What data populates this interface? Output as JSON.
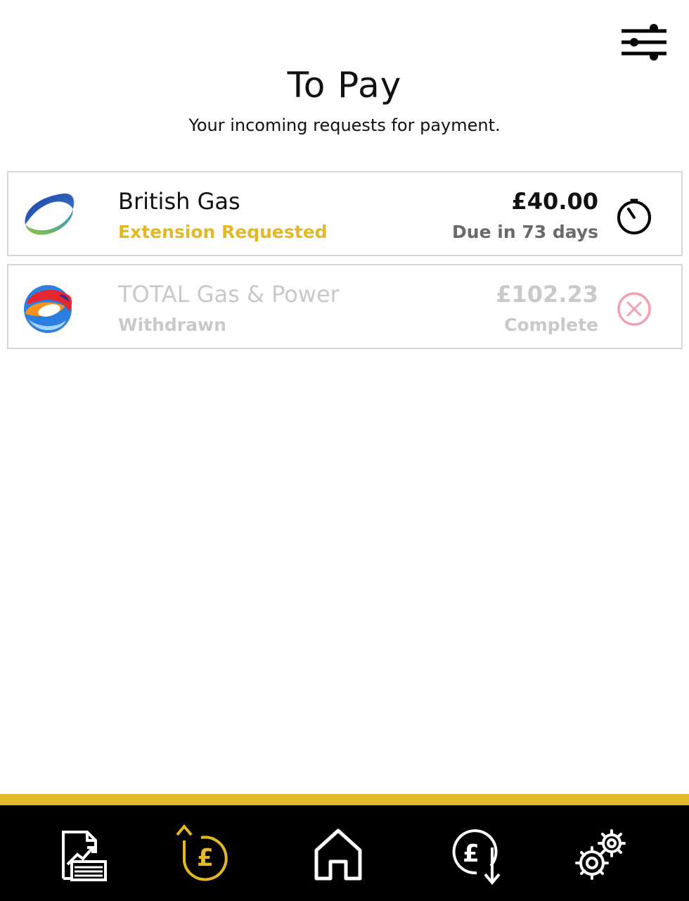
{
  "header": {
    "title": "To Pay",
    "subtitle": "Your incoming requests for payment."
  },
  "requests": [
    {
      "name": "British Gas",
      "status": "Extension Requested",
      "amount": "£40.00",
      "due": "Due in 73 days",
      "status_icon": "timer-icon",
      "status_color": "#e3b827"
    },
    {
      "name": "TOTAL Gas & Power",
      "status": "Withdrawn",
      "amount": "£102.23",
      "due": "Complete",
      "status_icon": "cancel-circle-icon",
      "status_color": "#c9c9c9"
    }
  ],
  "nav": {
    "items": [
      {
        "icon": "reports-icon"
      },
      {
        "icon": "to-pay-icon",
        "active": true
      },
      {
        "icon": "home-icon"
      },
      {
        "icon": "to-receive-icon"
      },
      {
        "icon": "settings-icon"
      }
    ],
    "accent": "#e3b827"
  },
  "colors": {
    "accent": "#e3b827",
    "nav_background": "#000000",
    "cancel_icon": "#f2a0b4"
  }
}
